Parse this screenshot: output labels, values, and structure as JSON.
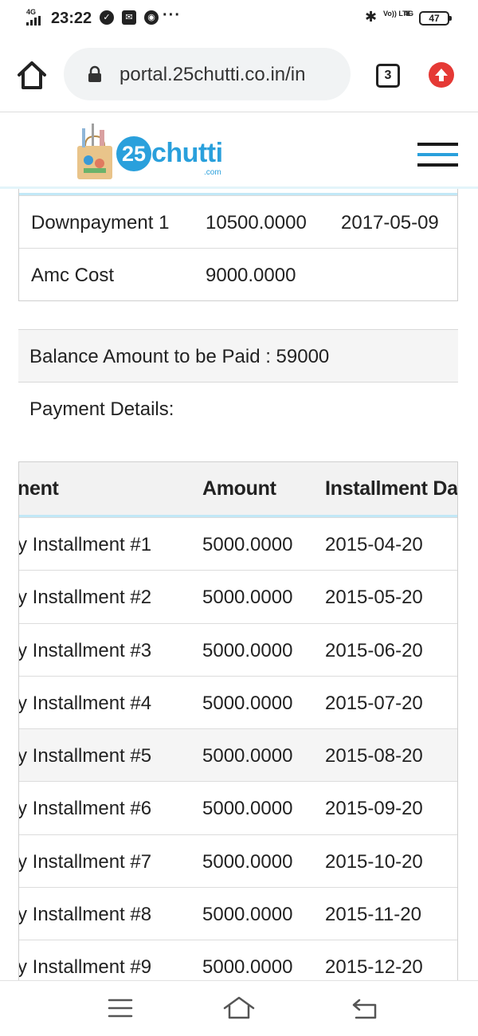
{
  "status_bar": {
    "network": "4G",
    "time": "23:22",
    "volte": "Vo)) LTE",
    "lte_badge": "4G",
    "battery": "47"
  },
  "browser": {
    "url": "portal.25chutti.co.in/in",
    "tab_count": "3"
  },
  "site": {
    "logo_number": "25",
    "logo_text": "chutti",
    "logo_suffix": ".com"
  },
  "cost_rows": [
    {
      "name": "Downpayment 1",
      "amount": "10500.0000",
      "date": "2017-05-09"
    },
    {
      "name": "Amc Cost",
      "amount": "9000.0000",
      "date": ""
    }
  ],
  "balance_text": "Balance Amount to be Paid : 59000",
  "payment_details_label": "Payment Details:",
  "installments": {
    "headers": [
      "nent",
      "Amount",
      "Installment Da"
    ],
    "rows": [
      {
        "name": "y Installment #1",
        "amount": "5000.0000",
        "date": "2015-04-20"
      },
      {
        "name": "y Installment #2",
        "amount": "5000.0000",
        "date": "2015-05-20"
      },
      {
        "name": "y Installment #3",
        "amount": "5000.0000",
        "date": "2015-06-20"
      },
      {
        "name": "y Installment #4",
        "amount": "5000.0000",
        "date": "2015-07-20"
      },
      {
        "name": "y Installment #5",
        "amount": "5000.0000",
        "date": "2015-08-20"
      },
      {
        "name": "y Installment #6",
        "amount": "5000.0000",
        "date": "2015-09-20"
      },
      {
        "name": "y Installment #7",
        "amount": "5000.0000",
        "date": "2015-10-20"
      },
      {
        "name": "y Installment #8",
        "amount": "5000.0000",
        "date": "2015-11-20"
      },
      {
        "name": "y Installment #9",
        "amount": "5000.0000",
        "date": "2015-12-20"
      }
    ]
  },
  "colors": {
    "brand": "#2aa0dc",
    "table_accent": "#c2e8f7",
    "update_red": "#e53935"
  }
}
